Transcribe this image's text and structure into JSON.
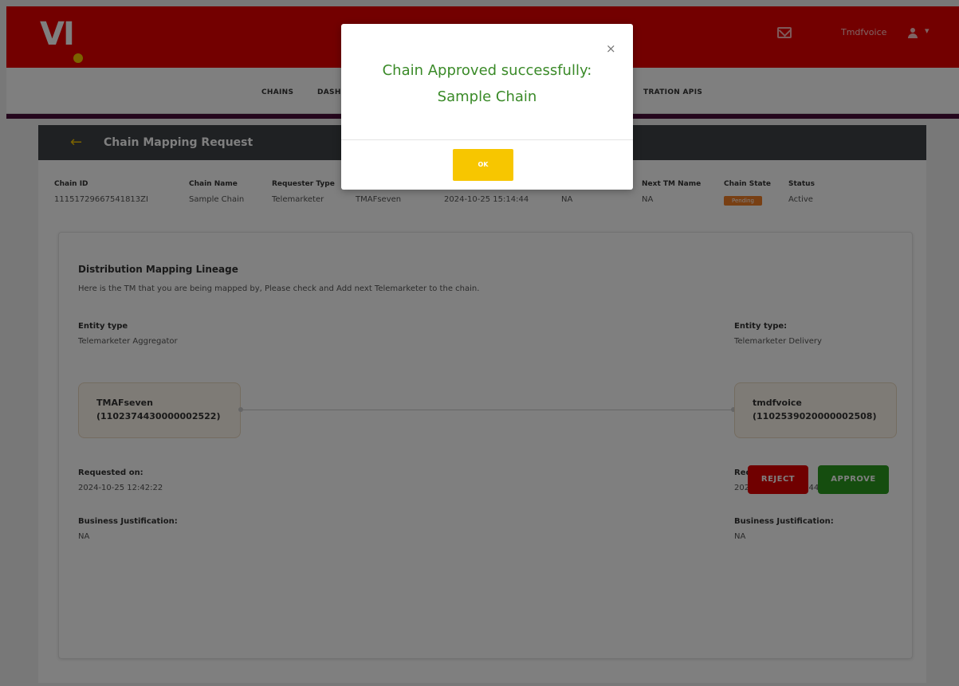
{
  "header": {
    "logo_text": "VI",
    "user_name": "Tmdfvoice",
    "user_caret": "▾"
  },
  "nav": {
    "items": [
      "CHAINS",
      "DASH",
      "TRATION APIS"
    ]
  },
  "section": {
    "title": "Chain Mapping Request",
    "back_icon": "←"
  },
  "chain_info": {
    "labels": {
      "chain_id": "Chain ID",
      "chain_name": "Chain Name",
      "requester_type": "Requester Type",
      "next_tm_name": "Next TM Name",
      "chain_state": "Chain State",
      "status": "Status"
    },
    "values": {
      "chain_id": "11151729667541813ZI",
      "chain_name": "Sample Chain",
      "requester_type": "Telemarketer",
      "requester_name": "TMAFseven",
      "requested_at": "2024-10-25 15:14:44",
      "na_field": "NA",
      "next_tm_name": "NA",
      "chain_state": "Pending",
      "status": "Active"
    }
  },
  "lineage": {
    "title": "Distribution Mapping Lineage",
    "description": "Here is the TM that you are being mapped by, Please check and Add next Telemarketer to the chain.",
    "left": {
      "entity_label": "Entity type",
      "entity_value": "Telemarketer Aggregator",
      "tm_name": "TMAFseven",
      "tm_id": "(1102374430000002522)",
      "requested_label": "Requested on:",
      "requested_value": "2024-10-25 12:42:22",
      "justification_label": "Business Justification:",
      "justification_value": "NA"
    },
    "right": {
      "entity_label": "Entity type:",
      "entity_value": "Telemarketer Delivery",
      "tm_name": "tmdfvoice",
      "tm_id": "(1102539020000002508)",
      "requested_label": "Requested on:",
      "requested_value": "2024-10-25 15:14:44",
      "justification_label": "Business Justification:",
      "justification_value": "NA"
    }
  },
  "actions": {
    "reject_label": "REJECT",
    "approve_label": "APPROVE"
  },
  "modal": {
    "message_line1": "Chain Approved successfully:",
    "message_line2": "Sample Chain",
    "close_icon": "×",
    "ok_label": "OK"
  },
  "colors": {
    "brand_red": "#e60000",
    "accent_yellow": "#f7c600",
    "success_green": "#2a9a1f",
    "nav_purple": "#4b0f3a",
    "pending_orange": "#f07e26"
  }
}
